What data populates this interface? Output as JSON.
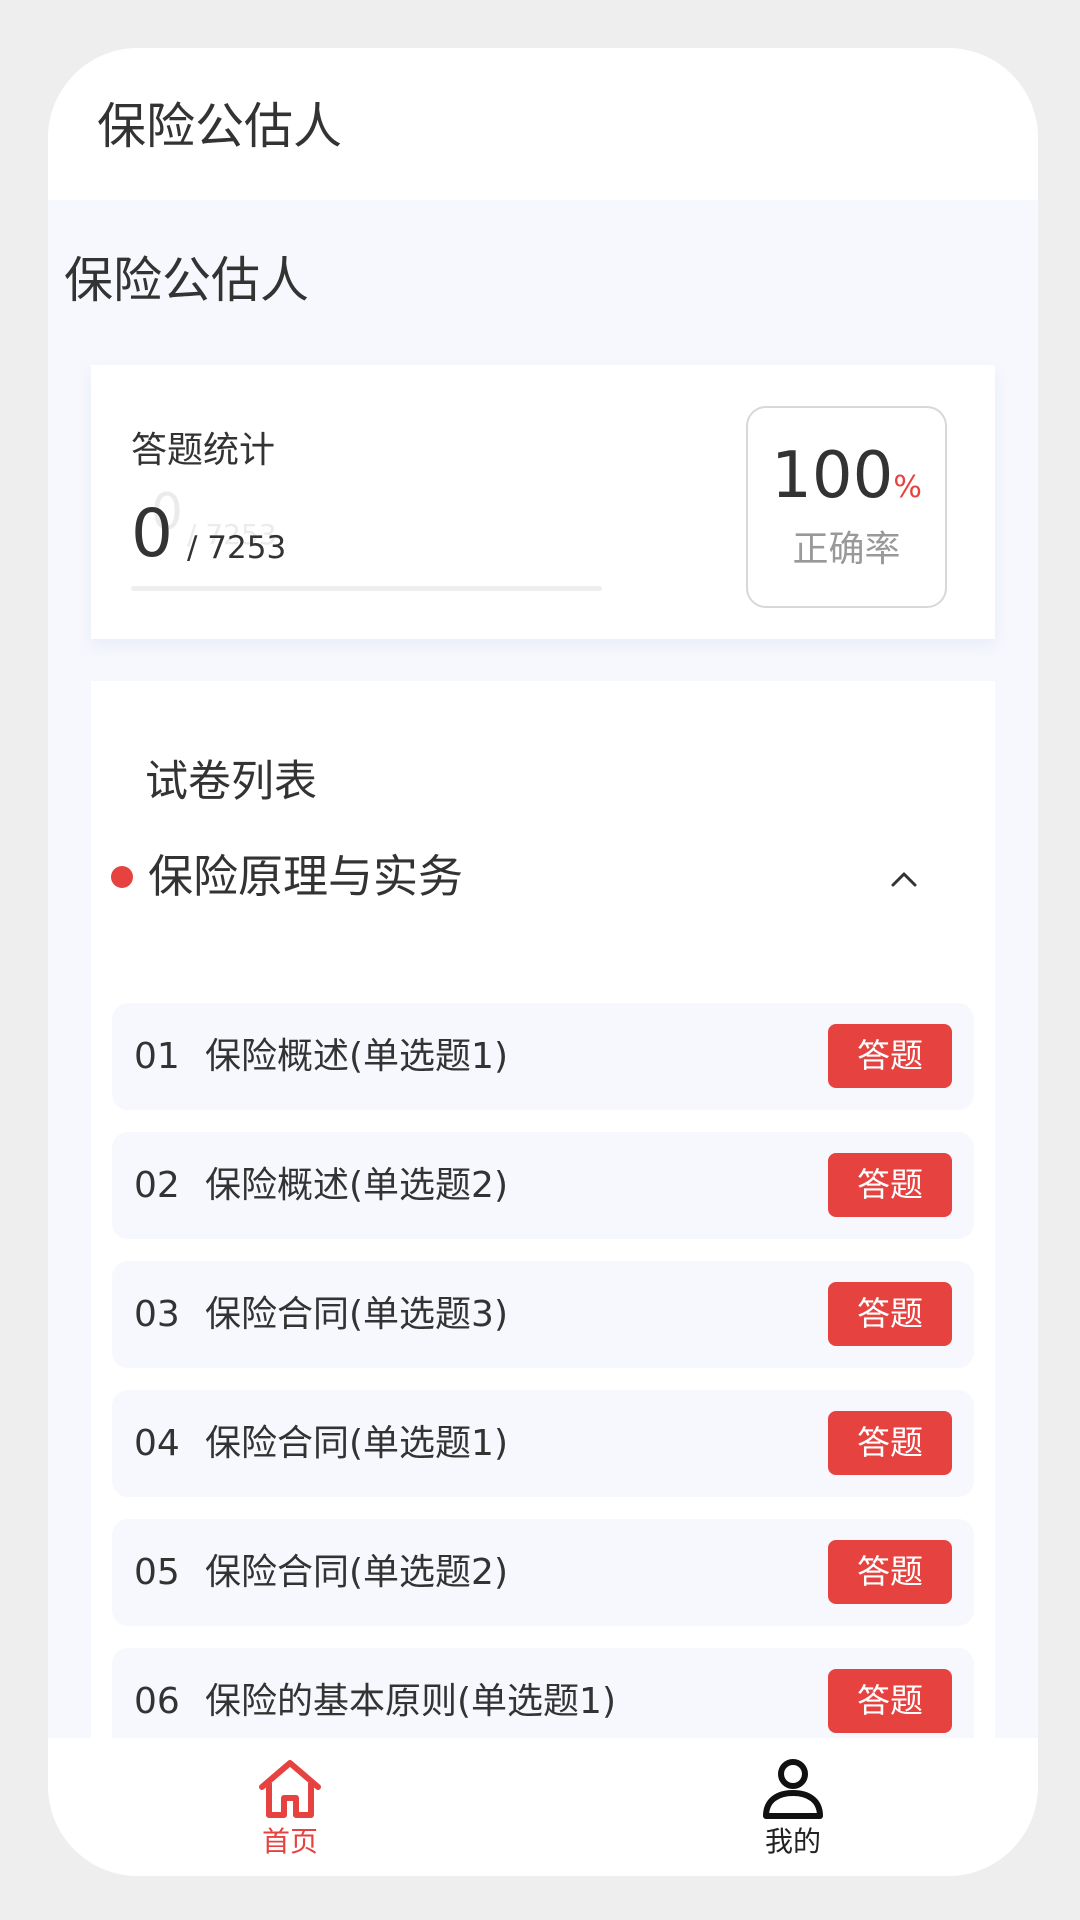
{
  "header": {
    "title": "保险公估人"
  },
  "page": {
    "title": "保险公估人"
  },
  "stats": {
    "label": "答题统计",
    "answered": "0",
    "total": "/ 7253",
    "ghost_answered": "0",
    "ghost_total": "/ 7253",
    "progress_fraction": 0,
    "rate_value": "100",
    "rate_unit": "%",
    "rate_label": "正确率"
  },
  "paper_list": {
    "title": "试卷列表",
    "group": {
      "title": "保险原理与实务",
      "expanded": true
    },
    "items": [
      {
        "num": "01",
        "name": "保险概述(单选题1)",
        "button": "答题"
      },
      {
        "num": "02",
        "name": "保险概述(单选题2)",
        "button": "答题"
      },
      {
        "num": "03",
        "name": "保险合同(单选题3)",
        "button": "答题"
      },
      {
        "num": "04",
        "name": "保险合同(单选题1)",
        "button": "答题"
      },
      {
        "num": "05",
        "name": "保险合同(单选题2)",
        "button": "答题"
      },
      {
        "num": "06",
        "name": "保险的基本原则(单选题1)",
        "button": "答题"
      }
    ]
  },
  "tabbar": {
    "items": [
      {
        "label": "首页",
        "icon": "home-icon",
        "active": true
      },
      {
        "label": "我的",
        "icon": "user-icon",
        "active": false
      }
    ]
  },
  "colors": {
    "accent": "#e64340",
    "background": "#f6f8fd",
    "text": "#333333",
    "muted": "#999999"
  }
}
